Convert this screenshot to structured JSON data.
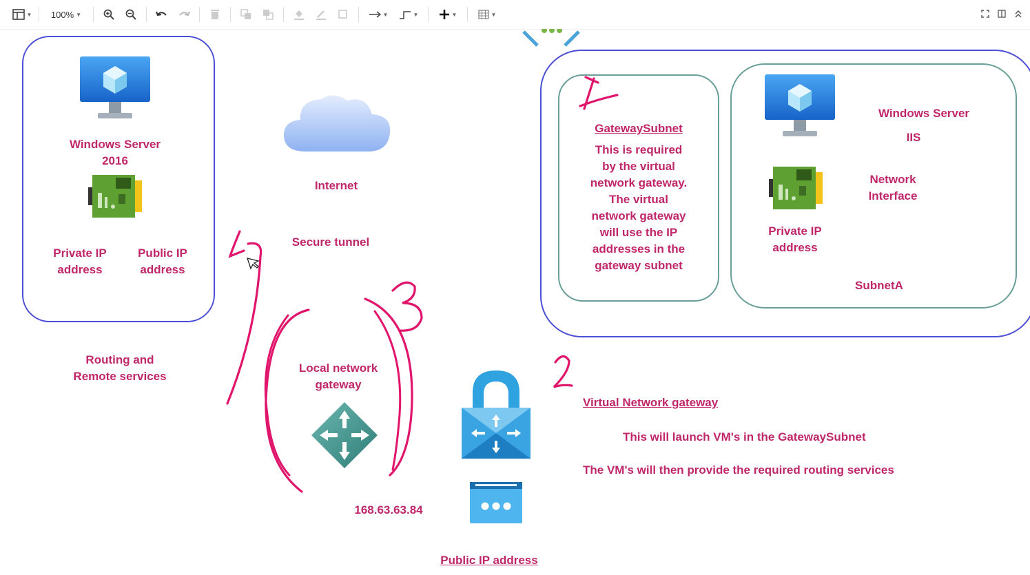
{
  "toolbar": {
    "zoom": "100%"
  },
  "left_box": {
    "server_label": "Windows Server\n2016",
    "private_ip": "Private IP\naddress",
    "public_ip": "Public IP\naddress"
  },
  "routing_label": "Routing and\nRemote services",
  "internet_label": "Internet",
  "secure_tunnel_label": "Secure tunnel",
  "local_gateway": {
    "label": "Local network\ngateway",
    "ip": "168.63.63.84"
  },
  "public_ip_label": "Public IP address",
  "gateway_subnet": {
    "title": "GatewaySubnet",
    "description": "This is required\nby the virtual\nnetwork gateway.\nThe virtual\nnetwork gateway\nwill use the IP\naddresses in the\ngateway subnet"
  },
  "subnet_a": {
    "server_label": "Windows Server",
    "iis_label": "IIS",
    "nic_label": "Network\nInterface",
    "private_ip": "Private IP\naddress",
    "name": "SubnetA"
  },
  "vnet_gateway": {
    "title": "Virtual Network gateway",
    "line1": "This will launch VM's in the GatewaySubnet",
    "line2": "The VM's will then provide the required routing services"
  },
  "annotations": {
    "one": "1",
    "two": "2",
    "three": "3",
    "four": "4"
  },
  "colors": {
    "label_pink": "#c0276a",
    "ink_pink": "#e0156b",
    "vnet_border": "#4a4fd6",
    "subnet_border": "#6a9f98"
  }
}
